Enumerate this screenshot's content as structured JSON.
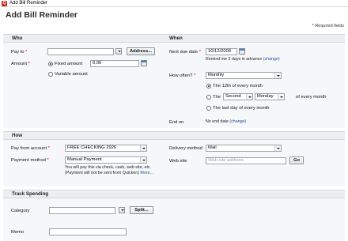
{
  "window": {
    "title": "Add Bill Reminder",
    "icon_letter": "Q"
  },
  "page": {
    "title": "Add Bill Reminder",
    "required_note": "Required fields"
  },
  "who": {
    "header": "Who",
    "pay_to_label": "Pay to",
    "pay_to_value": "",
    "address_button": "Address...",
    "amount_label": "Amount",
    "fixed_amount_label": "Fixed amount",
    "fixed_amount_value": "0.00",
    "variable_amount_label": "Variable amount"
  },
  "when": {
    "header": "When",
    "next_due_label": "Next due date",
    "next_due_value": "10/12/2009",
    "remind_text": "Remind me 3 days in advance",
    "change_link": "(change)",
    "how_often_label": "How often?",
    "how_often_value": "Monthly",
    "opt_12th": "The 12th of every month",
    "opt_the_label": "The",
    "ordinal_value": "Second",
    "weekday_value": "Monday",
    "of_every_month": "of every month",
    "opt_last_day": "The last day of every month",
    "end_on_label": "End on",
    "end_on_value": "No end date",
    "end_change_link": "(change)"
  },
  "how": {
    "header": "How",
    "pay_from_label": "Pay from account",
    "pay_from_value": "FREE CHECKING 2926",
    "payment_method_label": "Payment method",
    "payment_method_value": "Manual Payment",
    "note_line1": "You will pay this via check, cash, web site, etc.",
    "note_line2": "(Payment will not be sent from Quicken)",
    "more_link": "More...",
    "delivery_label": "Delivery method",
    "delivery_value": "Mail",
    "website_label": "Web site",
    "website_placeholder": "Web site address",
    "go_button": "Go"
  },
  "track": {
    "header": "Track Spending",
    "category_label": "Category",
    "category_value": "",
    "split_button": "Split...",
    "memo_label": "Memo",
    "memo_value": ""
  }
}
